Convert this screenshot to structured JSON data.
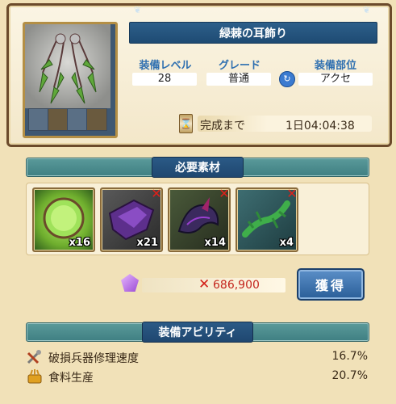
{
  "item": {
    "name": "緑棘の耳飾り",
    "equip_level_label": "装備レベル",
    "equip_level": "28",
    "grade_label": "グレード",
    "grade": "普通",
    "slot_label": "装備部位",
    "slot": "アクセ",
    "completion_label": "完成まで",
    "completion_time": "1日04:04:38"
  },
  "materials": {
    "title": "必要素材",
    "items": [
      {
        "name": "green-ring-material",
        "count": "x16",
        "missing": false,
        "color": "#8fd14f"
      },
      {
        "name": "purple-cloth-material",
        "count": "x21",
        "missing": true,
        "color": "#6b3fa0"
      },
      {
        "name": "dark-dragon-material",
        "count": "x14",
        "missing": true,
        "color": "#3a2858"
      },
      {
        "name": "green-lizard-material",
        "count": "x4",
        "missing": true,
        "color": "#3c9a4a"
      }
    ]
  },
  "cost": {
    "value": "686,900",
    "icon": "crystal-icon"
  },
  "acquire_button": "獲得",
  "abilities": {
    "title": "装備アビリティ",
    "items": [
      {
        "name": "破損兵器修理速度",
        "value": "16.7%",
        "icon": "tools-icon"
      },
      {
        "name": "食料生産",
        "value": "20.7%",
        "icon": "wheat-icon"
      }
    ]
  },
  "colors": {
    "banner_blue": "#1f4770",
    "section_teal": "#3f7f82",
    "cost_red": "#c4261e",
    "label_blue": "#2e6fb0"
  }
}
